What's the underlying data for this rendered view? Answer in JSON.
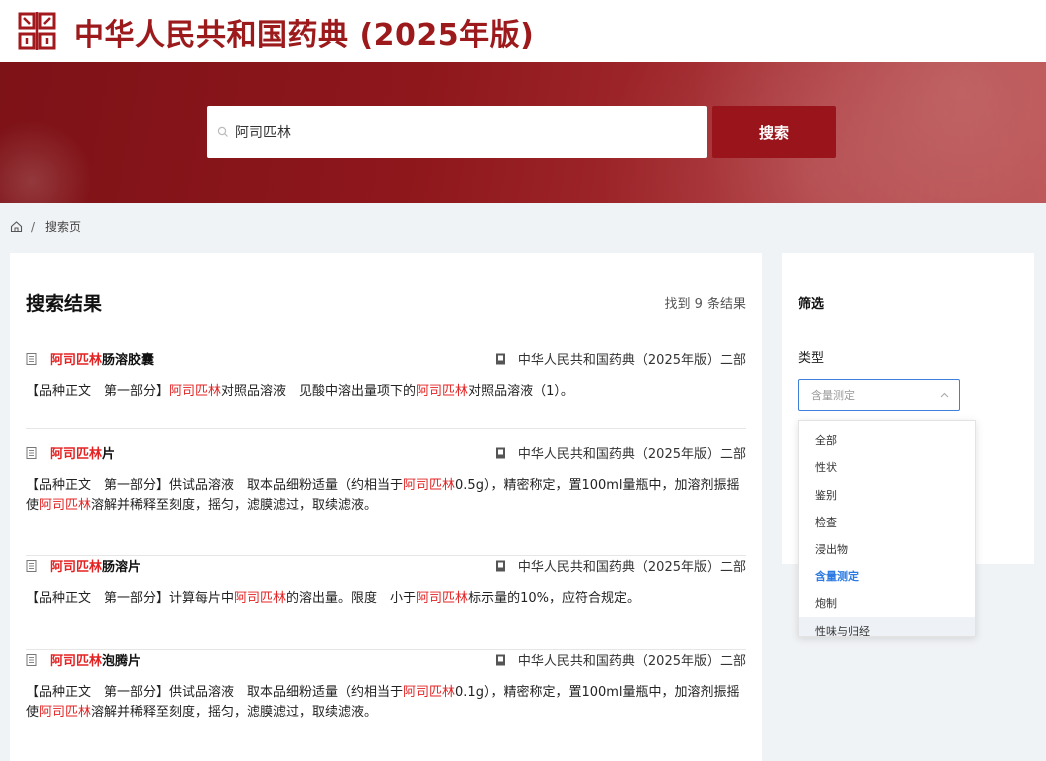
{
  "header": {
    "logo_name": "pharmacopoeia-seal-logo",
    "site_title": "中华人民共和国药典 (2025年版)"
  },
  "search": {
    "value": "阿司匹林",
    "button_label": "搜索"
  },
  "breadcrumb": {
    "current": "搜索页",
    "separator": "/"
  },
  "results": {
    "title": "搜索结果",
    "count_text": "找到 9 条结果",
    "items": [
      {
        "title_hl": "阿司匹林",
        "title_rest": "肠溶胶囊",
        "book": "中华人民共和国药典（2025年版）二部",
        "desc_parts": [
          {
            "t": "【品种正文　第一部分】",
            "h": false
          },
          {
            "t": "阿司匹林",
            "h": true
          },
          {
            "t": "对照品溶液　见酸中溶出量项下的",
            "h": false
          },
          {
            "t": "阿司匹林",
            "h": true
          },
          {
            "t": "对照品溶液（1）。",
            "h": false
          }
        ]
      },
      {
        "title_hl": "阿司匹林",
        "title_rest": "片",
        "book": "中华人民共和国药典（2025年版）二部",
        "desc_parts": [
          {
            "t": "【品种正文　第一部分】供试品溶液　取本品细粉适量（约相当于",
            "h": false
          },
          {
            "t": "阿司匹林",
            "h": true
          },
          {
            "t": "0.5g），精密称定，置100ml量瓶中，加溶剂振摇使",
            "h": false
          },
          {
            "t": "阿司匹林",
            "h": true
          },
          {
            "t": "溶解并稀释至刻度，摇匀，滤膜滤过，取续滤液。",
            "h": false
          }
        ]
      },
      {
        "title_hl": "阿司匹林",
        "title_rest": "肠溶片",
        "book": "中华人民共和国药典（2025年版）二部",
        "desc_parts": [
          {
            "t": "【品种正文　第一部分】计算每片中",
            "h": false
          },
          {
            "t": "阿司匹林",
            "h": true
          },
          {
            "t": "的溶出量。限度　小于",
            "h": false
          },
          {
            "t": "阿司匹林",
            "h": true
          },
          {
            "t": "标示量的10%，应符合规定。",
            "h": false
          }
        ]
      },
      {
        "title_hl": "阿司匹林",
        "title_rest": "泡腾片",
        "book": "中华人民共和国药典（2025年版）二部",
        "desc_parts": [
          {
            "t": "【品种正文　第一部分】供试品溶液　取本品细粉适量（约相当于",
            "h": false
          },
          {
            "t": "阿司匹林",
            "h": true
          },
          {
            "t": "0.1g），精密称定，置100ml量瓶中，加溶剂振摇使",
            "h": false
          },
          {
            "t": "阿司匹林",
            "h": true
          },
          {
            "t": "溶解并稀释至刻度，摇匀，滤膜滤过，取续滤液。",
            "h": false
          }
        ]
      }
    ]
  },
  "filter": {
    "title": "筛选",
    "type_label": "类型",
    "select_placeholder": "含量测定",
    "options": [
      "全部",
      "性状",
      "鉴别",
      "检查",
      "浸出物",
      "含量测定",
      "炮制",
      "性味与归经"
    ],
    "active_option": "含量测定",
    "hovered_option": "性味与归经"
  },
  "colors": {
    "brand_red": "#9a151b",
    "highlight_red": "#e32323",
    "active_blue": "#2b7be3"
  },
  "icons": {
    "search": "search-icon",
    "home": "home-icon",
    "document": "document-icon",
    "book": "book-icon",
    "chevron": "chevron-up-icon"
  }
}
